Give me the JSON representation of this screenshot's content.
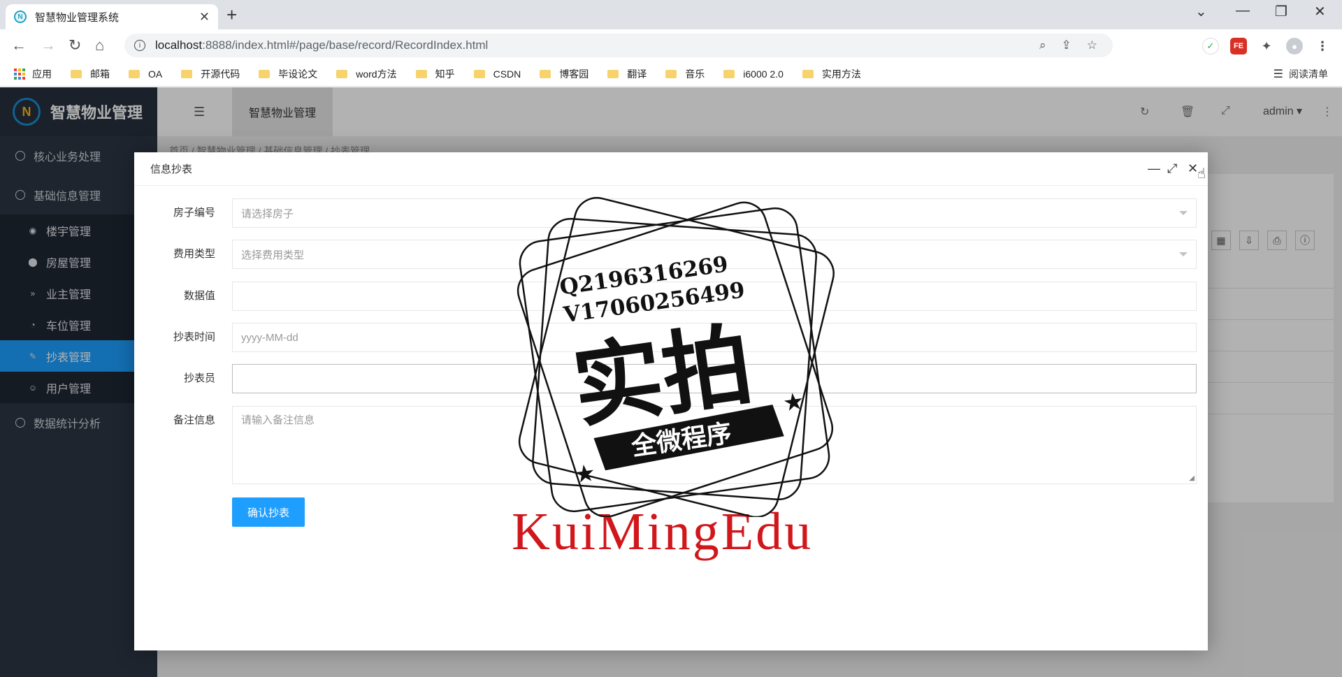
{
  "browser": {
    "tab_title": "智慧物业管理系统",
    "url_host": "localhost",
    "url_rest": ":8888/index.html#/page/base/record/RecordIndex.html",
    "bookmarks": [
      {
        "label": "应用",
        "type": "apps"
      },
      {
        "label": "邮箱",
        "type": "folder"
      },
      {
        "label": "OA",
        "type": "folder"
      },
      {
        "label": "开源代码",
        "type": "folder"
      },
      {
        "label": "毕设论文",
        "type": "folder"
      },
      {
        "label": "word方法",
        "type": "folder"
      },
      {
        "label": "知乎",
        "type": "folder"
      },
      {
        "label": "CSDN",
        "type": "folder"
      },
      {
        "label": "博客园",
        "type": "folder"
      },
      {
        "label": "翻译",
        "type": "folder"
      },
      {
        "label": "音乐",
        "type": "folder"
      },
      {
        "label": "i6000 2.0",
        "type": "folder"
      },
      {
        "label": "实用方法",
        "type": "folder"
      }
    ],
    "reading_list": "阅读清单"
  },
  "app": {
    "logo_text": "智慧物业管理",
    "top_title": "智慧物业管理",
    "user": "admin",
    "breadcrumb": "首页  /  智慧物业管理  /  基础信息管理  /  抄表管理",
    "menu": {
      "group1": "核心业务处理",
      "group2": "基础信息管理",
      "group3": "数据统计分析",
      "sub": [
        {
          "label": "楼宇管理",
          "icon": "target-icon"
        },
        {
          "label": "房屋管理",
          "icon": "house-icon"
        },
        {
          "label": "业主管理",
          "icon": "chevrons-down-icon"
        },
        {
          "label": "车位管理",
          "icon": "dashboard-icon"
        },
        {
          "label": "抄表管理",
          "icon": "edit-icon",
          "active": true
        },
        {
          "label": "用户管理",
          "icon": "user-icon"
        }
      ]
    }
  },
  "modal": {
    "title": "信息抄表",
    "fields": {
      "house_label": "房子编号",
      "house_placeholder": "请选择房子",
      "fee_label": "费用类型",
      "fee_placeholder": "选择费用类型",
      "value_label": "数据值",
      "value_value": "",
      "time_label": "抄表时间",
      "time_placeholder": "yyyy-MM-dd",
      "reader_label": "抄表员",
      "reader_value": "",
      "note_label": "备注信息",
      "note_placeholder": "请输入备注信息"
    },
    "submit_label": "确认抄表"
  },
  "overlay": {
    "watermark_text": "KuiMingEdu",
    "stamp_line1": "Q2196316269",
    "stamp_line2": "V17060256499",
    "stamp_big": "实拍",
    "stamp_ribbon": "全微程序"
  },
  "colors": {
    "accent": "#1e9fff",
    "sidebar": "#2b3544",
    "watermark": "#d0171c"
  }
}
